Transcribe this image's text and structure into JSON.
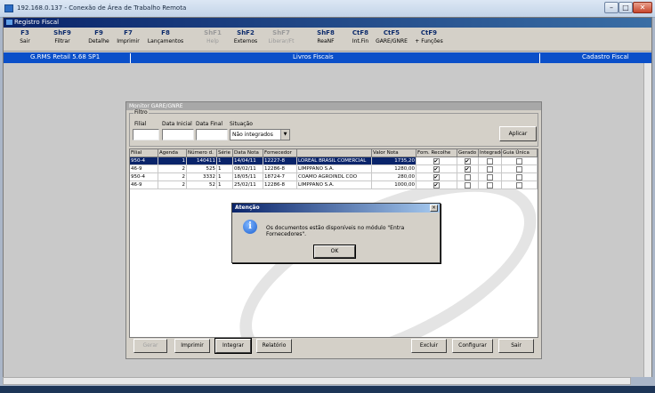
{
  "rdp": {
    "title": "192.168.0.137 - Conexão de Área de Trabalho Remota",
    "min": "–",
    "max": "□",
    "close": "✕"
  },
  "app": {
    "title": "Registro Fiscal"
  },
  "fkeys": [
    {
      "key": "F3",
      "label": "Sair",
      "enabled": true
    },
    {
      "key": "ShF9",
      "label": "Filtrar",
      "enabled": true
    },
    {
      "key": "F9",
      "label": "Detalhe",
      "enabled": true
    },
    {
      "key": "F7",
      "label": "Imprimir",
      "enabled": true
    },
    {
      "key": "F8",
      "label": "Lançamentos",
      "enabled": true
    },
    {
      "key": "ShF1",
      "label": "Help",
      "enabled": false
    },
    {
      "key": "ShF2",
      "label": "Externos",
      "enabled": true
    },
    {
      "key": "ShF7",
      "label": "Liberar/Ft",
      "enabled": false
    },
    {
      "key": "ShF8",
      "label": "ReaNF",
      "enabled": true
    },
    {
      "key": "CtF8",
      "label": "Int.Fin",
      "enabled": true
    },
    {
      "key": "CtF5",
      "label": "GARE/GNRE",
      "enabled": true
    },
    {
      "key": "CtF9",
      "label": "+ Funções",
      "enabled": true
    }
  ],
  "bar": {
    "left": "G.RMS Retail 5.68 SP1",
    "center": "Livros Fiscais",
    "right": "Cadastro Fiscal"
  },
  "monitor": {
    "title": "Monitor GARE/GNRE",
    "filter": {
      "legend": "Filtro",
      "filial_label": "Filial",
      "filial_value": "",
      "data_inicial_label": "Data Inicial",
      "data_inicial_value": "",
      "data_final_label": "Data Final",
      "data_final_value": "",
      "situacao_label": "Situação",
      "situacao_value": "Não integrados",
      "apply_button": "Aplicar"
    },
    "columns": [
      "Filial",
      "Agenda",
      "Número d.",
      "Série",
      "Data Nota",
      "Fornecedor",
      "",
      "Valor Nota",
      "Forn. Recolhe",
      "Gerado",
      "Integrado",
      "Guia Única"
    ],
    "rows": [
      {
        "filial": "950-4",
        "agenda": "1",
        "numero": "140411",
        "serie": "1",
        "data": "14/04/11",
        "cod": "12227-8",
        "fornecedor": "LOREAL BRASIL COMERCIAL",
        "valor": "1735,20",
        "forn": true,
        "gerado": true,
        "integrado": false,
        "guia": false,
        "selected": true
      },
      {
        "filial": "46-9",
        "agenda": "2",
        "numero": "525",
        "serie": "1",
        "data": "08/02/11",
        "cod": "12286-8",
        "fornecedor": "LIMPPANO S.A.",
        "valor": "1280,00",
        "forn": true,
        "gerado": true,
        "integrado": false,
        "guia": false,
        "selected": false
      },
      {
        "filial": "950-4",
        "agenda": "2",
        "numero": "3332",
        "serie": "1",
        "data": "18/05/11",
        "cod": "18724-7",
        "fornecedor": "COAMO AGROINDL COO",
        "valor": "280,00",
        "forn": true,
        "gerado": false,
        "integrado": false,
        "guia": false,
        "selected": false
      },
      {
        "filial": "46-9",
        "agenda": "2",
        "numero": "52",
        "serie": "1",
        "data": "25/02/11",
        "cod": "12286-8",
        "fornecedor": "LIMPPANO S.A.",
        "valor": "1000,00",
        "forn": true,
        "gerado": false,
        "integrado": false,
        "guia": false,
        "selected": false
      }
    ],
    "buttons": {
      "gerar": "Gerar",
      "imprimir": "Imprimir",
      "integrar": "Integrar",
      "relatorio": "Relatório",
      "excluir": "Excluir",
      "configurar": "Configurar",
      "sair": "Sair"
    }
  },
  "dialog": {
    "title": "Atenção",
    "message": "Os documentos estão disponíveis no módulo \"Entra Fornecedores\".",
    "ok": "OK",
    "close": "×"
  }
}
